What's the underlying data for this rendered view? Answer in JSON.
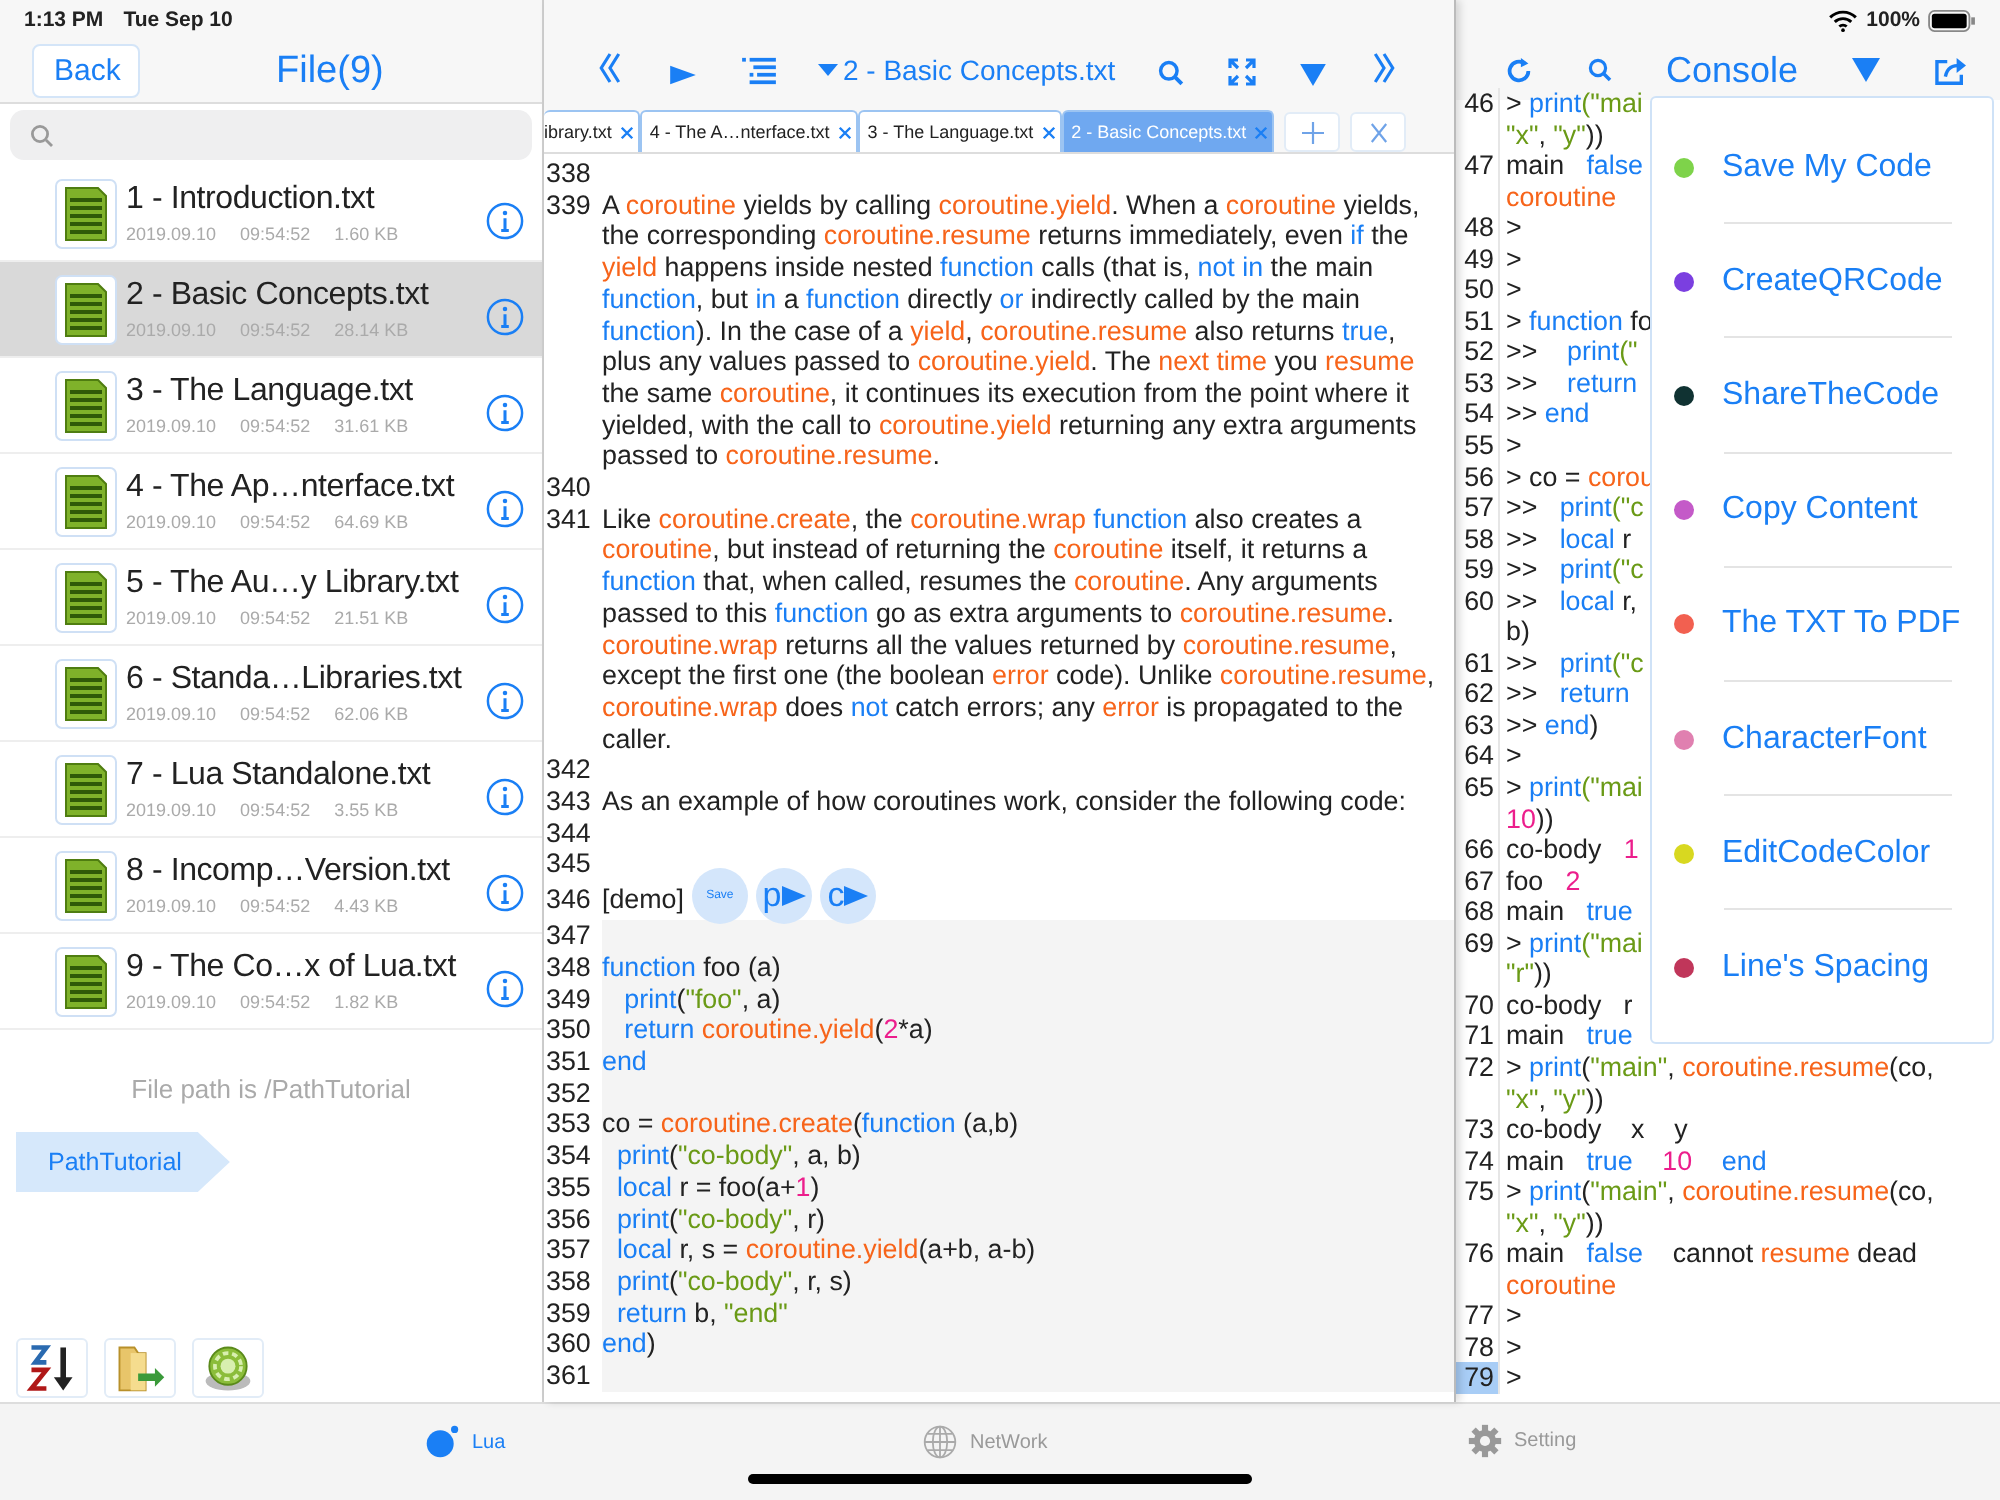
{
  "status_bar": {
    "time": "1:13 PM",
    "date": "Tue Sep 10",
    "battery": "100%"
  },
  "files_panel": {
    "back": "Back",
    "title": "File(9)",
    "files": [
      {
        "name": "1 - Introduction.txt",
        "date": "2019.09.10",
        "time": "09:54:52",
        "size": "1.60 KB",
        "selected": false
      },
      {
        "name": "2 - Basic Concepts.txt",
        "date": "2019.09.10",
        "time": "09:54:52",
        "size": "28.14 KB",
        "selected": true
      },
      {
        "name": "3 - The Language.txt",
        "date": "2019.09.10",
        "time": "09:54:52",
        "size": "31.61 KB",
        "selected": false
      },
      {
        "name": "4 - The Ap…nterface.txt",
        "date": "2019.09.10",
        "time": "09:54:52",
        "size": "64.69 KB",
        "selected": false
      },
      {
        "name": "5 - The Au…y Library.txt",
        "date": "2019.09.10",
        "time": "09:54:52",
        "size": "21.51 KB",
        "selected": false
      },
      {
        "name": "6 - Standa…Libraries.txt",
        "date": "2019.09.10",
        "time": "09:54:52",
        "size": "62.06 KB",
        "selected": false
      },
      {
        "name": "7 - Lua Standalone.txt",
        "date": "2019.09.10",
        "time": "09:54:52",
        "size": "3.55 KB",
        "selected": false
      },
      {
        "name": "8 - Incomp…Version.txt",
        "date": "2019.09.10",
        "time": "09:54:52",
        "size": "4.43 KB",
        "selected": false
      },
      {
        "name": "9 - The Co…x of Lua.txt",
        "date": "2019.09.10",
        "time": "09:54:52",
        "size": "1.82 KB",
        "selected": false
      }
    ],
    "path_note": "File path is /PathTutorial",
    "breadcrumb": "PathTutorial"
  },
  "editor": {
    "title": "2 - Basic Concepts.txt",
    "tabs": [
      {
        "label": "ibrary.txt",
        "selected": false
      },
      {
        "label": "4 - The A…nterface.txt",
        "selected": false
      },
      {
        "label": "3 - The Language.txt",
        "selected": false
      },
      {
        "label": "2 - Basic Concepts.txt",
        "selected": true
      }
    ],
    "lines": [
      {
        "num": "338",
        "kind": "prose"
      },
      {
        "num": "339",
        "kind": "prose",
        "segments": [
          {
            "text": "A ",
            "kind": "plain"
          },
          {
            "text": "coroutine",
            "kind": "lib"
          },
          {
            "text": " yields by calling ",
            "kind": "plain"
          },
          {
            "text": "coroutine.yield",
            "kind": "lib"
          },
          {
            "text": ". When a ",
            "kind": "plain"
          },
          {
            "text": "coroutine",
            "kind": "lib"
          },
          {
            "text": " yields, the corresponding ",
            "kind": "plain"
          },
          {
            "text": "coroutine.resume",
            "kind": "lib"
          },
          {
            "text": " returns immediately, even ",
            "kind": "plain"
          },
          {
            "text": "if",
            "kind": "keyword"
          },
          {
            "text": " the ",
            "kind": "plain"
          },
          {
            "text": "yield",
            "kind": "lib"
          },
          {
            "text": " happens inside nested ",
            "kind": "plain"
          },
          {
            "text": "function",
            "kind": "keyword"
          },
          {
            "text": " calls (that is, ",
            "kind": "plain"
          },
          {
            "text": "not in",
            "kind": "keyword"
          },
          {
            "text": " the main ",
            "kind": "plain"
          },
          {
            "text": "function",
            "kind": "keyword"
          },
          {
            "text": ", but ",
            "kind": "plain"
          },
          {
            "text": "in",
            "kind": "keyword"
          },
          {
            "text": " a ",
            "kind": "plain"
          },
          {
            "text": "function",
            "kind": "keyword"
          },
          {
            "text": " directly ",
            "kind": "plain"
          },
          {
            "text": "or",
            "kind": "keyword"
          },
          {
            "text": " indirectly called by the main ",
            "kind": "plain"
          },
          {
            "text": "function",
            "kind": "keyword"
          },
          {
            "text": "). In the case of a ",
            "kind": "plain"
          },
          {
            "text": "yield",
            "kind": "lib"
          },
          {
            "text": ", ",
            "kind": "plain"
          },
          {
            "text": "coroutine.resume",
            "kind": "lib"
          },
          {
            "text": " also returns ",
            "kind": "plain"
          },
          {
            "text": "true",
            "kind": "keyword"
          },
          {
            "text": ", plus any values passed to ",
            "kind": "plain"
          },
          {
            "text": "coroutine.yield",
            "kind": "lib"
          },
          {
            "text": ". The ",
            "kind": "plain"
          },
          {
            "text": "next time",
            "kind": "lib"
          },
          {
            "text": " you ",
            "kind": "plain"
          },
          {
            "text": "resume",
            "kind": "lib"
          },
          {
            "text": " the same ",
            "kind": "plain"
          },
          {
            "text": "coroutine",
            "kind": "lib"
          },
          {
            "text": ", it continues its execution from the point where it yielded, with the call to ",
            "kind": "plain"
          },
          {
            "text": "coroutine.yield",
            "kind": "lib"
          },
          {
            "text": " returning any extra arguments passed to ",
            "kind": "plain"
          },
          {
            "text": "coroutine.resume",
            "kind": "lib"
          },
          {
            "text": ".",
            "kind": "plain"
          }
        ]
      },
      {
        "num": "340",
        "kind": "prose"
      },
      {
        "num": "341",
        "kind": "prose",
        "segments": [
          {
            "text": "Like ",
            "kind": "plain"
          },
          {
            "text": "coroutine.create",
            "kind": "lib"
          },
          {
            "text": ", the ",
            "kind": "plain"
          },
          {
            "text": "coroutine.wrap",
            "kind": "lib"
          },
          {
            "text": " function",
            "kind": "keyword"
          },
          {
            "text": " also creates a ",
            "kind": "plain"
          },
          {
            "text": "coroutine",
            "kind": "lib"
          },
          {
            "text": ", but instead of returning the ",
            "kind": "plain"
          },
          {
            "text": "coroutine",
            "kind": "lib"
          },
          {
            "text": " itself, it returns a ",
            "kind": "plain"
          },
          {
            "text": "function",
            "kind": "keyword"
          },
          {
            "text": " that, when called, resumes the ",
            "kind": "plain"
          },
          {
            "text": "coroutine",
            "kind": "lib"
          },
          {
            "text": ". Any arguments passed to this ",
            "kind": "plain"
          },
          {
            "text": "function",
            "kind": "keyword"
          },
          {
            "text": " go as extra arguments to ",
            "kind": "plain"
          },
          {
            "text": "coroutine.resume",
            "kind": "lib"
          },
          {
            "text": ". ",
            "kind": "plain"
          },
          {
            "text": "coroutine.wrap",
            "kind": "lib"
          },
          {
            "text": " returns all the values returned by ",
            "kind": "plain"
          },
          {
            "text": "coroutine.resume",
            "kind": "lib"
          },
          {
            "text": ", except the first one (the boolean ",
            "kind": "plain"
          },
          {
            "text": "error",
            "kind": "lib"
          },
          {
            "text": " code). Unlike ",
            "kind": "plain"
          },
          {
            "text": "coroutine.resume",
            "kind": "lib"
          },
          {
            "text": ", ",
            "kind": "plain"
          },
          {
            "text": "coroutine.wrap",
            "kind": "lib"
          },
          {
            "text": " does ",
            "kind": "plain"
          },
          {
            "text": "not",
            "kind": "keyword"
          },
          {
            "text": " catch errors; any ",
            "kind": "plain"
          },
          {
            "text": "error",
            "kind": "lib"
          },
          {
            "text": " is propagated to the caller.",
            "kind": "plain"
          }
        ]
      },
      {
        "num": "342",
        "kind": "prose"
      },
      {
        "num": "343",
        "kind": "prose",
        "segments": [
          {
            "text": "As an example of how coroutines work, consider the following code:",
            "kind": "plain"
          }
        ]
      },
      {
        "num": "344",
        "kind": "prose"
      },
      {
        "num": "345",
        "kind": "prose"
      },
      {
        "num": "346",
        "kind": "demo",
        "segments": [
          {
            "text": "[demo]",
            "kind": "plain"
          }
        ],
        "buttons": [
          {
            "label": "Save",
            "kind": "save"
          },
          {
            "label": "p",
            "kind": "run"
          },
          {
            "label": "c",
            "kind": "run"
          }
        ]
      },
      {
        "num": "347",
        "kind": "code"
      },
      {
        "num": "348",
        "kind": "code",
        "segments": [
          {
            "text": "function",
            "kind": "keyword"
          },
          {
            "text": " foo (a)",
            "kind": "plain"
          }
        ]
      },
      {
        "num": "349",
        "kind": "code",
        "segments": [
          {
            "text": "   print",
            "kind": "keyword"
          },
          {
            "text": "(",
            "kind": "plain"
          },
          {
            "text": "\"foo\"",
            "kind": "string"
          },
          {
            "text": ", a)",
            "kind": "plain"
          }
        ]
      },
      {
        "num": "350",
        "kind": "code",
        "segments": [
          {
            "text": "   return ",
            "kind": "keyword"
          },
          {
            "text": "coroutine.yield",
            "kind": "lib"
          },
          {
            "text": "(",
            "kind": "plain"
          },
          {
            "text": "2",
            "kind": "number"
          },
          {
            "text": "*a)",
            "kind": "plain"
          }
        ]
      },
      {
        "num": "351",
        "kind": "code",
        "segments": [
          {
            "text": "end",
            "kind": "keyword"
          }
        ]
      },
      {
        "num": "352",
        "kind": "code"
      },
      {
        "num": "353",
        "kind": "code",
        "segments": [
          {
            "text": "co = ",
            "kind": "plain"
          },
          {
            "text": "coroutine.create",
            "kind": "lib"
          },
          {
            "text": "(",
            "kind": "plain"
          },
          {
            "text": "function",
            "kind": "keyword"
          },
          {
            "text": " (a,b)",
            "kind": "plain"
          }
        ]
      },
      {
        "num": "354",
        "kind": "code",
        "segments": [
          {
            "text": "  print",
            "kind": "keyword"
          },
          {
            "text": "(",
            "kind": "plain"
          },
          {
            "text": "\"co-body\"",
            "kind": "string"
          },
          {
            "text": ", a, b)",
            "kind": "plain"
          }
        ]
      },
      {
        "num": "355",
        "kind": "code",
        "segments": [
          {
            "text": "  local",
            "kind": "keyword"
          },
          {
            "text": " r = foo(a+",
            "kind": "plain"
          },
          {
            "text": "1",
            "kind": "number"
          },
          {
            "text": ")",
            "kind": "plain"
          }
        ]
      },
      {
        "num": "356",
        "kind": "code",
        "segments": [
          {
            "text": "  print",
            "kind": "keyword"
          },
          {
            "text": "(",
            "kind": "plain"
          },
          {
            "text": "\"co-body\"",
            "kind": "string"
          },
          {
            "text": ", r)",
            "kind": "plain"
          }
        ]
      },
      {
        "num": "357",
        "kind": "code",
        "segments": [
          {
            "text": "  local",
            "kind": "keyword"
          },
          {
            "text": " r, s = ",
            "kind": "plain"
          },
          {
            "text": "coroutine.yield",
            "kind": "lib"
          },
          {
            "text": "(a+b, a-b)",
            "kind": "plain"
          }
        ]
      },
      {
        "num": "358",
        "kind": "code",
        "segments": [
          {
            "text": "  print",
            "kind": "keyword"
          },
          {
            "text": "(",
            "kind": "plain"
          },
          {
            "text": "\"co-body\"",
            "kind": "string"
          },
          {
            "text": ", r, s)",
            "kind": "plain"
          }
        ]
      },
      {
        "num": "359",
        "kind": "code",
        "segments": [
          {
            "text": "  return",
            "kind": "keyword"
          },
          {
            "text": " b, ",
            "kind": "plain"
          },
          {
            "text": "\"end\"",
            "kind": "string"
          }
        ]
      },
      {
        "num": "360",
        "kind": "code",
        "segments": [
          {
            "text": "end",
            "kind": "keyword"
          },
          {
            "text": ")",
            "kind": "plain"
          }
        ]
      },
      {
        "num": "361",
        "kind": "code"
      }
    ]
  },
  "console": {
    "title": "Console",
    "lines": [
      {
        "num": "46",
        "selected": false,
        "rows": [
          {
            "segments": [
              {
                "text": "> ",
                "kind": "plain"
              },
              {
                "text": "print",
                "kind": "keyword"
              },
              {
                "text": "(\"mai",
                "kind": "string"
              }
            ]
          },
          {
            "segments": [
              {
                "text": "\"x\"",
                "kind": "string"
              },
              {
                "text": ", ",
                "kind": "plain"
              },
              {
                "text": "\"y\"",
                "kind": "string"
              },
              {
                "text": "))",
                "kind": "plain"
              }
            ]
          }
        ]
      },
      {
        "num": "47",
        "selected": false,
        "rows": [
          {
            "segments": [
              {
                "text": "main   ",
                "kind": "plain"
              },
              {
                "text": "false",
                "kind": "keyword"
              }
            ]
          },
          {
            "segments": [
              {
                "text": "coroutine",
                "kind": "lib"
              }
            ]
          }
        ]
      },
      {
        "num": "48",
        "selected": false,
        "rows": [
          {
            "segments": [
              {
                "text": ">",
                "kind": "plain"
              }
            ]
          }
        ]
      },
      {
        "num": "49",
        "selected": false,
        "rows": [
          {
            "segments": [
              {
                "text": ">",
                "kind": "plain"
              }
            ]
          }
        ]
      },
      {
        "num": "50",
        "selected": false,
        "rows": [
          {
            "segments": [
              {
                "text": ">",
                "kind": "plain"
              }
            ]
          }
        ]
      },
      {
        "num": "51",
        "selected": false,
        "rows": [
          {
            "segments": [
              {
                "text": "> ",
                "kind": "plain"
              },
              {
                "text": "function",
                "kind": "keyword"
              },
              {
                "text": " fo",
                "kind": "plain"
              }
            ]
          }
        ]
      },
      {
        "num": "52",
        "selected": false,
        "rows": [
          {
            "segments": [
              {
                "text": ">>    ",
                "kind": "plain"
              },
              {
                "text": "print",
                "kind": "keyword"
              },
              {
                "text": "(\"",
                "kind": "string"
              }
            ]
          }
        ]
      },
      {
        "num": "53",
        "selected": false,
        "rows": [
          {
            "segments": [
              {
                "text": ">>    ",
                "kind": "plain"
              },
              {
                "text": "return",
                "kind": "keyword"
              }
            ]
          }
        ]
      },
      {
        "num": "54",
        "selected": false,
        "rows": [
          {
            "segments": [
              {
                "text": ">> ",
                "kind": "plain"
              },
              {
                "text": "end",
                "kind": "keyword"
              }
            ]
          }
        ]
      },
      {
        "num": "55",
        "selected": false,
        "rows": [
          {
            "segments": [
              {
                "text": ">",
                "kind": "plain"
              }
            ]
          }
        ]
      },
      {
        "num": "56",
        "selected": false,
        "rows": [
          {
            "segments": [
              {
                "text": "> co = ",
                "kind": "plain"
              },
              {
                "text": "corou",
                "kind": "lib"
              }
            ]
          }
        ]
      },
      {
        "num": "57",
        "selected": false,
        "rows": [
          {
            "segments": [
              {
                "text": ">>   ",
                "kind": "plain"
              },
              {
                "text": "print",
                "kind": "keyword"
              },
              {
                "text": "(\"c",
                "kind": "string"
              }
            ]
          }
        ]
      },
      {
        "num": "58",
        "selected": false,
        "rows": [
          {
            "segments": [
              {
                "text": ">>   ",
                "kind": "plain"
              },
              {
                "text": "local",
                "kind": "keyword"
              },
              {
                "text": " r",
                "kind": "plain"
              }
            ]
          }
        ]
      },
      {
        "num": "59",
        "selected": false,
        "rows": [
          {
            "segments": [
              {
                "text": ">>   ",
                "kind": "plain"
              },
              {
                "text": "print",
                "kind": "keyword"
              },
              {
                "text": "(\"c",
                "kind": "string"
              }
            ]
          }
        ]
      },
      {
        "num": "60",
        "selected": false,
        "rows": [
          {
            "segments": [
              {
                "text": ">>   ",
                "kind": "plain"
              },
              {
                "text": "local",
                "kind": "keyword"
              },
              {
                "text": " r,",
                "kind": "plain"
              }
            ]
          },
          {
            "segments": [
              {
                "text": "b)",
                "kind": "plain"
              }
            ]
          }
        ]
      },
      {
        "num": "61",
        "selected": false,
        "rows": [
          {
            "segments": [
              {
                "text": ">>   ",
                "kind": "plain"
              },
              {
                "text": "print",
                "kind": "keyword"
              },
              {
                "text": "(\"c",
                "kind": "string"
              }
            ]
          }
        ]
      },
      {
        "num": "62",
        "selected": false,
        "rows": [
          {
            "segments": [
              {
                "text": ">>   ",
                "kind": "plain"
              },
              {
                "text": "return",
                "kind": "keyword"
              }
            ]
          }
        ]
      },
      {
        "num": "63",
        "selected": false,
        "rows": [
          {
            "segments": [
              {
                "text": ">> ",
                "kind": "plain"
              },
              {
                "text": "end",
                "kind": "keyword"
              },
              {
                "text": ")",
                "kind": "plain"
              }
            ]
          }
        ]
      },
      {
        "num": "64",
        "selected": false,
        "rows": [
          {
            "segments": [
              {
                "text": ">",
                "kind": "plain"
              }
            ]
          }
        ]
      },
      {
        "num": "65",
        "selected": false,
        "rows": [
          {
            "segments": [
              {
                "text": "> ",
                "kind": "plain"
              },
              {
                "text": "print",
                "kind": "keyword"
              },
              {
                "text": "(\"mai",
                "kind": "string"
              }
            ]
          },
          {
            "segments": [
              {
                "text": "10",
                "kind": "number"
              },
              {
                "text": "))",
                "kind": "plain"
              }
            ]
          }
        ]
      },
      {
        "num": "66",
        "selected": false,
        "rows": [
          {
            "segments": [
              {
                "text": "co-body   ",
                "kind": "plain"
              },
              {
                "text": "1",
                "kind": "number"
              }
            ]
          }
        ]
      },
      {
        "num": "67",
        "selected": false,
        "rows": [
          {
            "segments": [
              {
                "text": "foo   ",
                "kind": "plain"
              },
              {
                "text": "2",
                "kind": "number"
              }
            ]
          }
        ]
      },
      {
        "num": "68",
        "selected": false,
        "rows": [
          {
            "segments": [
              {
                "text": "main   ",
                "kind": "plain"
              },
              {
                "text": "true",
                "kind": "keyword"
              }
            ]
          }
        ]
      },
      {
        "num": "69",
        "selected": false,
        "rows": [
          {
            "segments": [
              {
                "text": "> ",
                "kind": "plain"
              },
              {
                "text": "print",
                "kind": "keyword"
              },
              {
                "text": "(\"mai",
                "kind": "string"
              }
            ]
          },
          {
            "segments": [
              {
                "text": "\"r\"",
                "kind": "string"
              },
              {
                "text": "))",
                "kind": "plain"
              }
            ]
          }
        ]
      },
      {
        "num": "70",
        "selected": false,
        "rows": [
          {
            "segments": [
              {
                "text": "co-body   r",
                "kind": "plain"
              }
            ]
          }
        ]
      },
      {
        "num": "71",
        "selected": false,
        "rows": [
          {
            "segments": [
              {
                "text": "main   ",
                "kind": "plain"
              },
              {
                "text": "true",
                "kind": "keyword"
              }
            ]
          }
        ]
      },
      {
        "num": "72",
        "selected": false,
        "rows": [
          {
            "segments": [
              {
                "text": "> ",
                "kind": "plain"
              },
              {
                "text": "print",
                "kind": "keyword"
              },
              {
                "text": "(",
                "kind": "plain"
              },
              {
                "text": "\"main\"",
                "kind": "string"
              },
              {
                "text": ", ",
                "kind": "plain"
              },
              {
                "text": "coroutine.resume",
                "kind": "lib"
              },
              {
                "text": "(co,",
                "kind": "plain"
              }
            ]
          },
          {
            "segments": [
              {
                "text": "\"x\"",
                "kind": "string"
              },
              {
                "text": ", ",
                "kind": "plain"
              },
              {
                "text": "\"y\"",
                "kind": "string"
              },
              {
                "text": "))",
                "kind": "plain"
              }
            ]
          }
        ]
      },
      {
        "num": "73",
        "selected": false,
        "rows": [
          {
            "segments": [
              {
                "text": "co-body    x    y",
                "kind": "plain"
              }
            ]
          }
        ]
      },
      {
        "num": "74",
        "selected": false,
        "rows": [
          {
            "segments": [
              {
                "text": "main   ",
                "kind": "plain"
              },
              {
                "text": "true",
                "kind": "keyword"
              },
              {
                "text": "    10",
                "kind": "number"
              },
              {
                "text": "    end",
                "kind": "keyword"
              }
            ]
          }
        ]
      },
      {
        "num": "75",
        "selected": false,
        "rows": [
          {
            "segments": [
              {
                "text": "> ",
                "kind": "plain"
              },
              {
                "text": "print",
                "kind": "keyword"
              },
              {
                "text": "(",
                "kind": "plain"
              },
              {
                "text": "\"main\"",
                "kind": "string"
              },
              {
                "text": ", ",
                "kind": "plain"
              },
              {
                "text": "coroutine.resume",
                "kind": "lib"
              },
              {
                "text": "(co,",
                "kind": "plain"
              }
            ]
          },
          {
            "segments": [
              {
                "text": "\"x\"",
                "kind": "string"
              },
              {
                "text": ", ",
                "kind": "plain"
              },
              {
                "text": "\"y\"",
                "kind": "string"
              },
              {
                "text": "))",
                "kind": "plain"
              }
            ]
          }
        ]
      },
      {
        "num": "76",
        "selected": false,
        "rows": [
          {
            "segments": [
              {
                "text": "main   ",
                "kind": "plain"
              },
              {
                "text": "false",
                "kind": "keyword"
              },
              {
                "text": "    cannot ",
                "kind": "plain"
              },
              {
                "text": "resume",
                "kind": "lib"
              },
              {
                "text": " dead",
                "kind": "plain"
              }
            ]
          },
          {
            "segments": [
              {
                "text": "coroutine",
                "kind": "lib"
              }
            ]
          }
        ]
      },
      {
        "num": "77",
        "selected": false,
        "rows": [
          {
            "segments": [
              {
                "text": ">",
                "kind": "plain"
              }
            ]
          }
        ]
      },
      {
        "num": "78",
        "selected": false,
        "rows": [
          {
            "segments": [
              {
                "text": ">",
                "kind": "plain"
              }
            ]
          }
        ]
      },
      {
        "num": "79",
        "selected": true,
        "rows": [
          {
            "segments": [
              {
                "text": ">",
                "kind": "plain"
              }
            ]
          }
        ]
      }
    ]
  },
  "menu": [
    {
      "label": "Save My Code",
      "color": "#7ed34a"
    },
    {
      "label": "CreateQRCode",
      "color": "#7b3fe0"
    },
    {
      "label": "ShareTheCode",
      "color": "#103232"
    },
    {
      "label": "Copy Content",
      "color": "#c45ac8"
    },
    {
      "label": "The TXT To PDF",
      "color": "#f26050"
    },
    {
      "label": "CharacterFont",
      "color": "#e080b0"
    },
    {
      "label": "EditCodeColor",
      "color": "#d8d820"
    },
    {
      "label": "Line's Spacing",
      "color": "#c0365a"
    }
  ],
  "tab_bar": [
    {
      "label": "Lua",
      "kind": "lua",
      "selected": true
    },
    {
      "label": "NetWork",
      "kind": "network",
      "selected": false
    },
    {
      "label": "Setting",
      "kind": "setting",
      "selected": false
    }
  ]
}
